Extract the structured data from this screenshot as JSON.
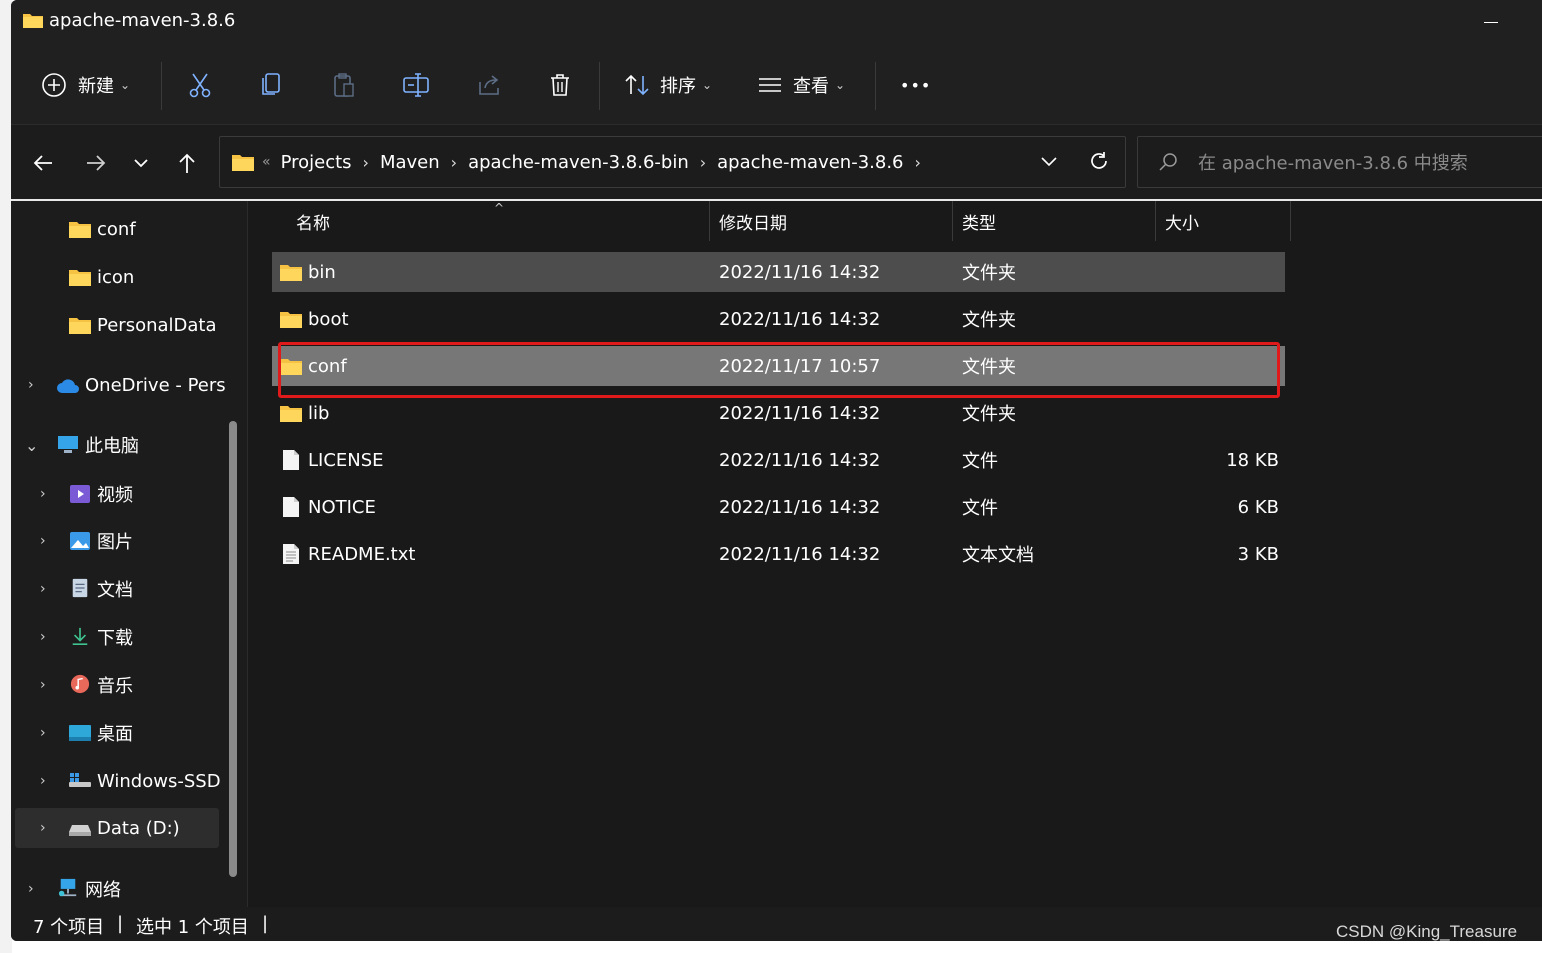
{
  "window": {
    "title": "apache-maven-3.8.6"
  },
  "toolbar": {
    "new_label": "新建",
    "sort_label": "排序",
    "view_label": "查看",
    "more_label": "•••"
  },
  "address": {
    "overflow": "«",
    "crumbs": [
      "Projects",
      "Maven",
      "apache-maven-3.8.6-bin",
      "apache-maven-3.8.6"
    ]
  },
  "search": {
    "placeholder": "在 apache-maven-3.8.6 中搜索"
  },
  "sidebar": {
    "items": [
      {
        "label": "conf",
        "icon": "folder-icon"
      },
      {
        "label": "icon",
        "icon": "folder-icon"
      },
      {
        "label": "PersonalData",
        "icon": "folder-icon"
      },
      {
        "label": "OneDrive - Pers",
        "icon": "cloud-icon"
      },
      {
        "label": "此电脑",
        "icon": "computer-icon"
      },
      {
        "label": "视频",
        "icon": "video-icon"
      },
      {
        "label": "图片",
        "icon": "picture-icon"
      },
      {
        "label": "文档",
        "icon": "document-icon"
      },
      {
        "label": "下载",
        "icon": "download-icon"
      },
      {
        "label": "音乐",
        "icon": "music-icon"
      },
      {
        "label": "桌面",
        "icon": "desktop-icon"
      },
      {
        "label": "Windows-SSD",
        "icon": "drive-icon"
      },
      {
        "label": "Data (D:)",
        "icon": "drive-icon"
      },
      {
        "label": "网络",
        "icon": "network-icon"
      }
    ]
  },
  "columns": {
    "name": "名称",
    "modified": "修改日期",
    "type": "类型",
    "size": "大小"
  },
  "files": [
    {
      "name": "bin",
      "modified": "2022/11/16 14:32",
      "type": "文件夹",
      "size": "",
      "icon": "folder-icon"
    },
    {
      "name": "boot",
      "modified": "2022/11/16 14:32",
      "type": "文件夹",
      "size": "",
      "icon": "folder-icon"
    },
    {
      "name": "conf",
      "modified": "2022/11/17 10:57",
      "type": "文件夹",
      "size": "",
      "icon": "folder-icon"
    },
    {
      "name": "lib",
      "modified": "2022/11/16 14:32",
      "type": "文件夹",
      "size": "",
      "icon": "folder-icon"
    },
    {
      "name": "LICENSE",
      "modified": "2022/11/16 14:32",
      "type": "文件",
      "size": "18 KB",
      "icon": "file-icon"
    },
    {
      "name": "NOTICE",
      "modified": "2022/11/16 14:32",
      "type": "文件",
      "size": "6 KB",
      "icon": "file-icon"
    },
    {
      "name": "README.txt",
      "modified": "2022/11/16 14:32",
      "type": "文本文档",
      "size": "3 KB",
      "icon": "text-file-icon"
    }
  ],
  "status": {
    "count": "7 个项目",
    "selected": "选中 1 个项目",
    "sep": "|"
  },
  "watermark": "CSDN @King_Treasure",
  "colors": {
    "highlight": "#e01a1a",
    "folder": "#f6c244",
    "selected_row": "#4d4d4d",
    "hover_row": "#777777"
  }
}
